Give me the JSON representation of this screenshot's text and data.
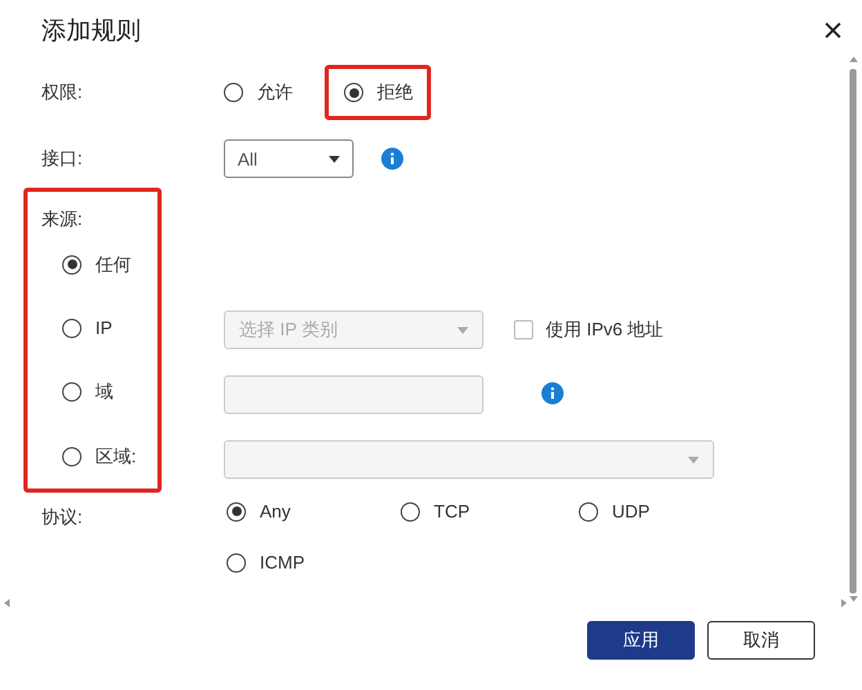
{
  "dialog": {
    "title": "添加规则"
  },
  "permission": {
    "label": "权限:",
    "options": [
      {
        "label": "允许",
        "selected": false,
        "highlighted": false
      },
      {
        "label": "拒绝",
        "selected": true,
        "highlighted": true
      }
    ]
  },
  "interface": {
    "label": "接口:",
    "value": "All"
  },
  "source": {
    "label": "来源:",
    "highlighted": true,
    "options": [
      {
        "label": "任何",
        "selected": true,
        "kind": "any"
      },
      {
        "label": "IP",
        "selected": false,
        "kind": "ip"
      },
      {
        "label": "域",
        "selected": false,
        "kind": "domain"
      },
      {
        "label": "区域:",
        "selected": false,
        "kind": "region"
      }
    ],
    "ip_type": {
      "placeholder": "选择 IP 类别"
    },
    "ipv6": {
      "label": "使用 IPv6 地址",
      "checked": false
    }
  },
  "protocol": {
    "label": "协议:",
    "options": [
      {
        "label": "Any",
        "selected": true
      },
      {
        "label": "TCP",
        "selected": false
      },
      {
        "label": "UDP",
        "selected": false
      },
      {
        "label": "ICMP",
        "selected": false
      }
    ]
  },
  "buttons": [
    {
      "label": "应用",
      "kind": "primary"
    },
    {
      "label": "取消",
      "kind": "secondary"
    }
  ]
}
